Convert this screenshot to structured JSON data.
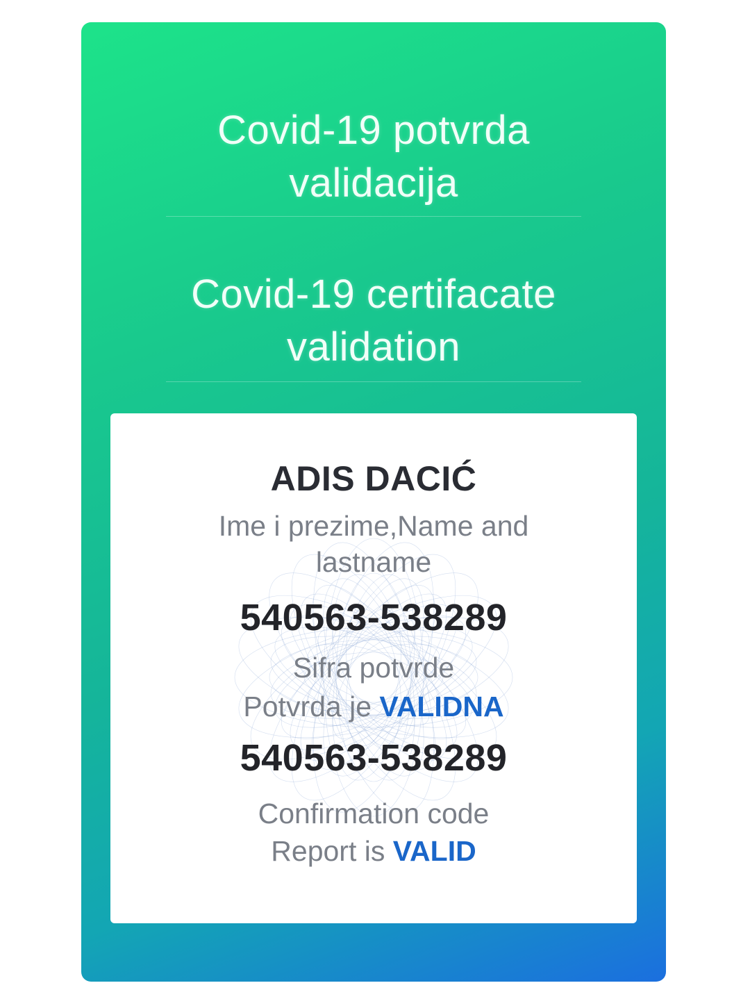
{
  "header": {
    "title_local": [
      "Covid-19 potvrda",
      "validacija"
    ],
    "title_en": [
      "Covid-19 certifacate",
      "validation"
    ]
  },
  "certificate": {
    "holder_name": "ADIS DACIĆ",
    "name_caption": [
      "Ime i prezime,Name and",
      "lastname"
    ],
    "code_local": "540563-538289",
    "code_caption_local": "Sifra potvrde",
    "status_prefix_local": "Potvrda je ",
    "status_value_local": "VALIDNA",
    "code_en": "540563-538289",
    "code_caption_en": "Confirmation code",
    "status_prefix_en": "Report is ",
    "status_value_en": "VALID"
  },
  "colors": {
    "gradient_start": "#1de38a",
    "gradient_end": "#1b6fdf",
    "valid_text": "#1a66c9"
  }
}
